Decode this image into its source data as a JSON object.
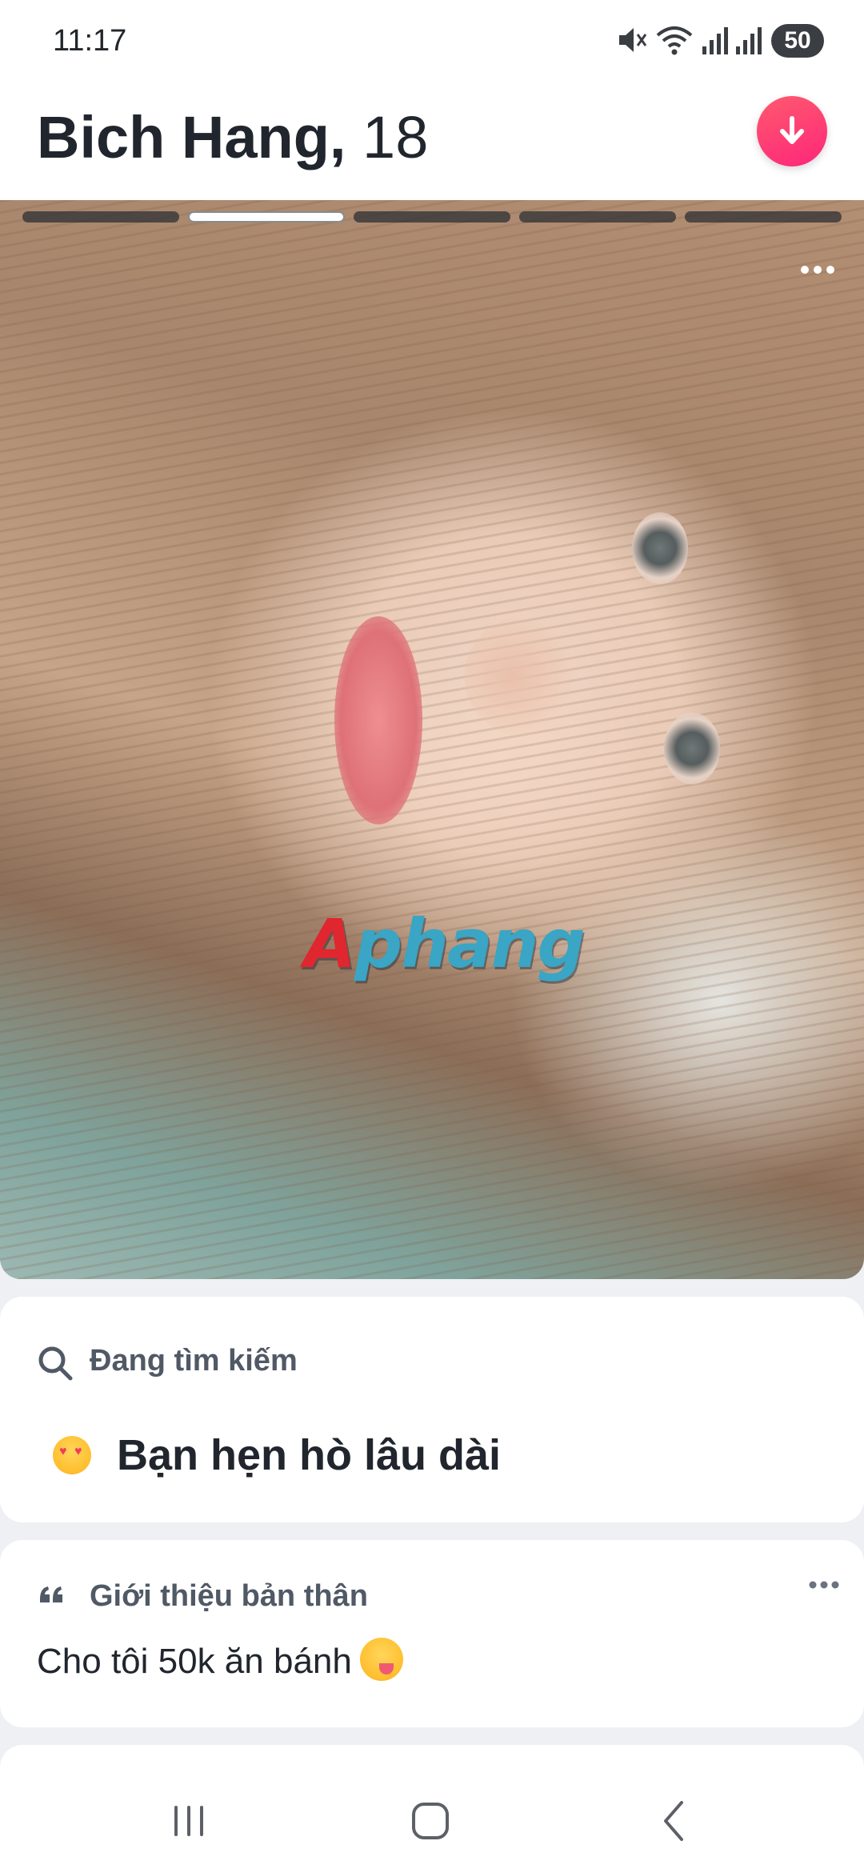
{
  "status_bar": {
    "time": "11:17",
    "battery_level": "50",
    "icons": [
      "mute-icon",
      "wifi-icon",
      "signal-icon",
      "signal-icon",
      "battery-icon"
    ]
  },
  "header": {
    "name": "Bich Hang,",
    "age": "18",
    "collapse_icon": "arrow-down-icon",
    "accent_color": "#fd267a"
  },
  "photo": {
    "segments_total": 5,
    "active_segment_index": 1,
    "more_icon": "more-horizontal-icon",
    "watermark": {
      "first": "A",
      "rest": "phang"
    }
  },
  "looking_for": {
    "label": "Đang tìm kiếm",
    "icon": "search-icon",
    "value": "Bạn hẹn hò lâu dài",
    "value_icon": "heart-eyes-emoji"
  },
  "about": {
    "label": "Giới thiệu bản thân",
    "icon": "quote-icon",
    "text": "Cho tôi 50k ăn bánh",
    "text_icon": "yum-emoji",
    "more_icon": "more-horizontal-icon"
  },
  "nav_bar": {
    "items": [
      "recent-apps-icon",
      "home-icon",
      "back-icon"
    ]
  }
}
